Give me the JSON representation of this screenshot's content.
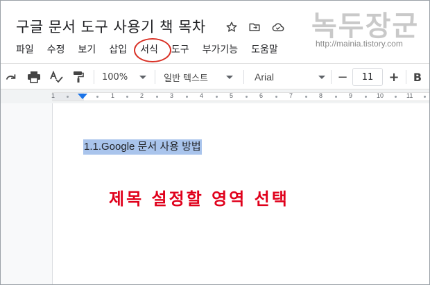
{
  "doc": {
    "title": "구글 문서 도구 사용기 책 목차"
  },
  "watermark": {
    "brand": "녹두장군",
    "url": "http://mainia.tistory.com"
  },
  "menu": [
    {
      "label": "파일"
    },
    {
      "label": "수정"
    },
    {
      "label": "보기"
    },
    {
      "label": "삽입"
    },
    {
      "label": "서식",
      "highlighted": true
    },
    {
      "label": "도구"
    },
    {
      "label": "부가기능"
    },
    {
      "label": "도움말"
    }
  ],
  "toolbar": {
    "zoom": "100%",
    "style": "일반 텍스트",
    "font": "Arial",
    "font_size": "11",
    "minus": "−",
    "plus": "+",
    "bold": "B"
  },
  "ruler": {
    "numbers": [
      "1",
      "1",
      "2",
      "3",
      "4",
      "5",
      "6",
      "7",
      "8",
      "9",
      "10",
      "11"
    ]
  },
  "body": {
    "selected_heading": "1.1.Google 문서 사용 방법",
    "annotation": "제목 설정할 영역 선택"
  },
  "colors": {
    "selection": "#a9c4ec",
    "annotation": "#e0001b",
    "accent": "#1a73e8",
    "menu_circle": "#d93025"
  }
}
